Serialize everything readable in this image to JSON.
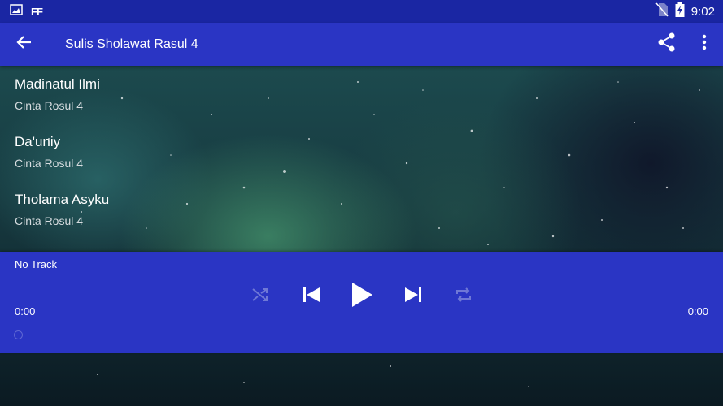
{
  "status_bar": {
    "time": "9:02",
    "left_icons": [
      "image-icon",
      "ff-icon"
    ],
    "ff_label": "FF",
    "right_icons": [
      "no-sim-icon",
      "battery-charging-icon"
    ]
  },
  "toolbar": {
    "title": "Sulis Sholawat Rasul 4",
    "back_icon": "arrow-back-icon",
    "share_icon": "share-icon",
    "more_icon": "more-vert-icon"
  },
  "tracks": [
    {
      "title": "Madinatul Ilmi",
      "artist": "Cinta Rosul 4"
    },
    {
      "title": "Da'uniy",
      "artist": "Cinta Rosul 4"
    },
    {
      "title": "Tholama Asyku",
      "artist": "Cinta Rosul 4"
    }
  ],
  "player": {
    "now_playing": "No Track",
    "elapsed": "0:00",
    "duration": "0:00",
    "progress": 0,
    "controls": [
      "shuffle-icon",
      "skip-previous-icon",
      "play-icon",
      "skip-next-icon",
      "repeat-icon"
    ]
  },
  "colors": {
    "status_bar": "#1a26a3",
    "toolbar": "#2a35c4",
    "player": "#2a35c4",
    "disabled_icon": "#6f78d6"
  }
}
